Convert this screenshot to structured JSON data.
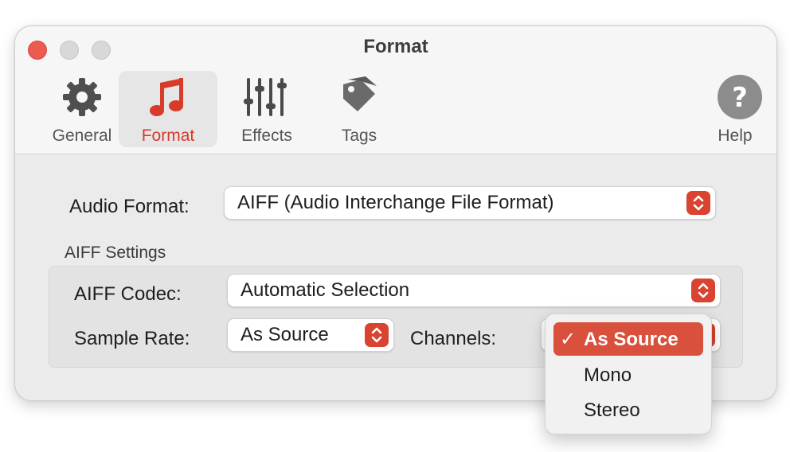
{
  "window": {
    "title": "Format"
  },
  "toolbar": {
    "items": [
      {
        "label": "General",
        "icon": "gear-icon"
      },
      {
        "label": "Format",
        "icon": "music-note-icon",
        "selected": true
      },
      {
        "label": "Effects",
        "icon": "sliders-icon"
      },
      {
        "label": "Tags",
        "icon": "tag-icon"
      },
      {
        "label": "Help",
        "icon": "question-icon"
      }
    ]
  },
  "format": {
    "audio_format_label": "Audio Format:",
    "audio_format_value": "AIFF (Audio Interchange File Format)"
  },
  "aiff_settings": {
    "title": "AIFF Settings",
    "codec_label": "AIFF Codec:",
    "codec_value": "Automatic Selection",
    "sample_rate_label": "Sample Rate:",
    "sample_rate_value": "As Source",
    "channels_label": "Channels:"
  },
  "channels_menu": {
    "options": [
      {
        "label": "As Source",
        "selected": true,
        "check": "✓"
      },
      {
        "label": "Mono",
        "selected": false
      },
      {
        "label": "Stereo",
        "selected": false
      }
    ]
  },
  "colors": {
    "accent": "#d9432f",
    "close": "#ed5b50"
  }
}
